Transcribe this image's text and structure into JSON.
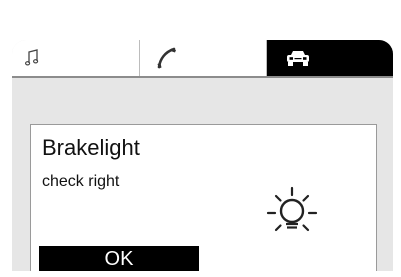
{
  "tabs": [
    {
      "id": "audio",
      "icon": "music-note-icon",
      "active": false
    },
    {
      "id": "phone",
      "icon": "phone-handset-icon",
      "active": false
    },
    {
      "id": "vehicle",
      "icon": "car-front-icon",
      "active": true
    }
  ],
  "dialog": {
    "title": "Brakelight",
    "message": "check right",
    "icon": "bulb-warning-icon",
    "ok_label": "OK"
  },
  "colors": {
    "active_tab": "#000000",
    "panel_background": "#e6e6e6",
    "dialog_background": "#ffffff",
    "button_background": "#000000",
    "button_text": "#ffffff"
  }
}
